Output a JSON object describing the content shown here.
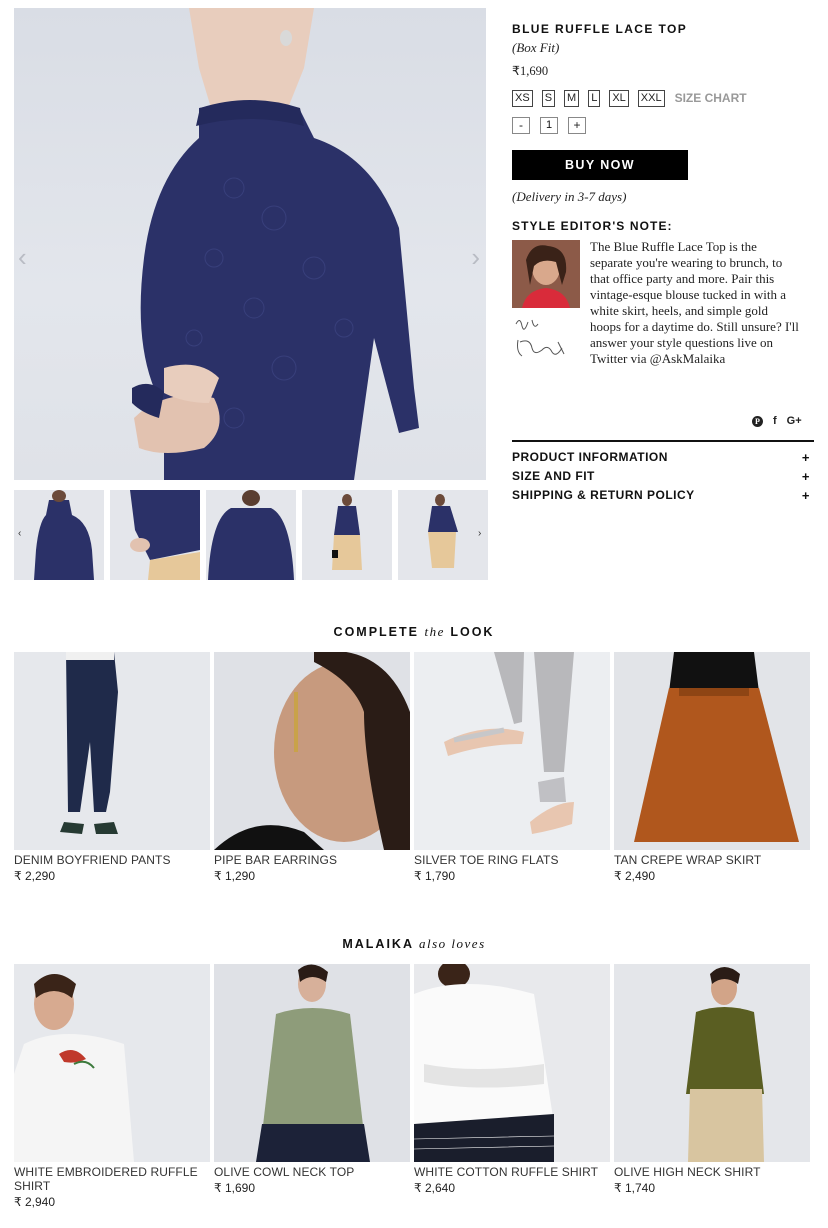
{
  "product": {
    "title": "BLUE RUFFLE LACE TOP",
    "fit": "(Box Fit)",
    "price": "₹1,690",
    "sizes": [
      "XS",
      "S",
      "M",
      "L",
      "XL",
      "XXL"
    ],
    "size_chart_label": "SIZE CHART",
    "quantity": {
      "minus": "-",
      "value": "1",
      "plus": "+"
    },
    "buy_label": "BUY NOW",
    "delivery": "(Delivery in 3-7 days)"
  },
  "gallery": {
    "prev_arrow": "‹",
    "next_arrow": "›",
    "thumb_prev": "‹",
    "thumb_next": "›",
    "thumb_count": 5
  },
  "editor_note": {
    "heading": "STYLE EDITOR'S NOTE:",
    "body": "The Blue Ruffle Lace Top is the separate you're wearing to brunch, to that office party and more. Pair this vintage-esque blouse tucked in with a white skirt, heels, and simple gold hoops for a daytime do. Still unsure? I'll answer your style questions live on Twitter via @AskMalaika"
  },
  "social": {
    "pinterest": "P",
    "facebook": "f",
    "google": "G+"
  },
  "accordion": [
    {
      "label": "PRODUCT INFORMATION",
      "icon": "+"
    },
    {
      "label": "SIZE AND FIT",
      "icon": "+"
    },
    {
      "label": "SHIPPING & RETURN POLICY",
      "icon": "+"
    }
  ],
  "complete_look": {
    "title_pre": "COMPLETE ",
    "title_em": "the",
    "title_post": " LOOK",
    "items": [
      {
        "name": "DENIM BOYFRIEND PANTS",
        "price": "₹ 2,290"
      },
      {
        "name": "PIPE BAR EARRINGS",
        "price": "₹ 1,290"
      },
      {
        "name": "SILVER TOE RING FLATS",
        "price": "₹ 1,790"
      },
      {
        "name": "TAN CREPE WRAP SKIRT",
        "price": "₹ 2,490"
      }
    ]
  },
  "also_loves": {
    "title_pre": "MALAIKA ",
    "title_em": "also loves",
    "items": [
      {
        "name": "WHITE EMBROIDERED RUFFLE SHIRT",
        "price": "₹ 2,940"
      },
      {
        "name": "OLIVE COWL NECK TOP",
        "price": "₹ 1,690"
      },
      {
        "name": "WHITE COTTON RUFFLE SHIRT",
        "price": "₹ 2,640"
      },
      {
        "name": "OLIVE HIGH NECK SHIRT",
        "price": "₹ 1,740"
      }
    ]
  },
  "colors": {
    "accent": "#000000",
    "navy_top": "#2b3168",
    "muted": "#999999"
  }
}
